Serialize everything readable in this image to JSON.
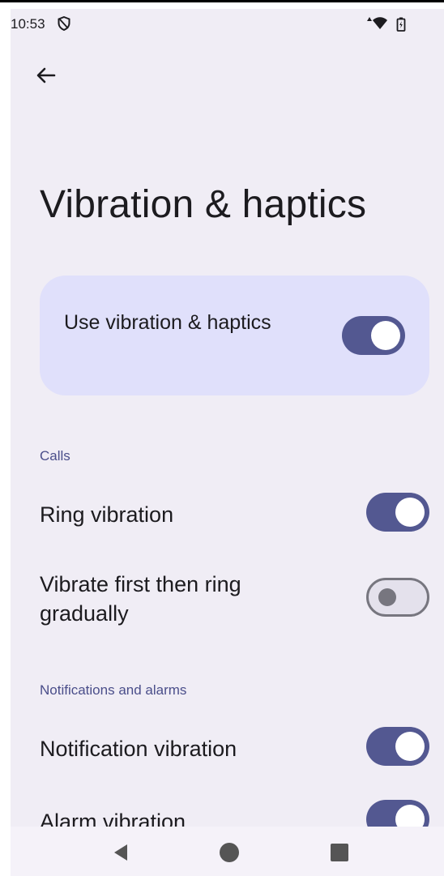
{
  "status_bar": {
    "time": "10:53"
  },
  "header": {
    "title": "Vibration & haptics"
  },
  "main_toggle": {
    "label": "Use vibration & haptics",
    "enabled": true
  },
  "sections": [
    {
      "header": "Calls",
      "items": [
        {
          "label": "Ring vibration",
          "enabled": true
        },
        {
          "label": "Vibrate first then ring gradually",
          "enabled": false
        }
      ]
    },
    {
      "header": "Notifications and alarms",
      "items": [
        {
          "label": "Notification vibration",
          "enabled": true
        },
        {
          "label": "Alarm vibration",
          "enabled": true
        }
      ]
    }
  ],
  "nav_bar": {
    "buttons": [
      "back-icon",
      "home-icon",
      "recents-icon"
    ]
  },
  "colors": {
    "background": "#f0edf5",
    "card": "#e0e0fb",
    "toggle_on": "#535891",
    "toggle_off_track": "#e4e1ec",
    "toggle_off_border": "#77767f",
    "section_header": "#4a4e8a",
    "text": "#1c1b1f"
  }
}
